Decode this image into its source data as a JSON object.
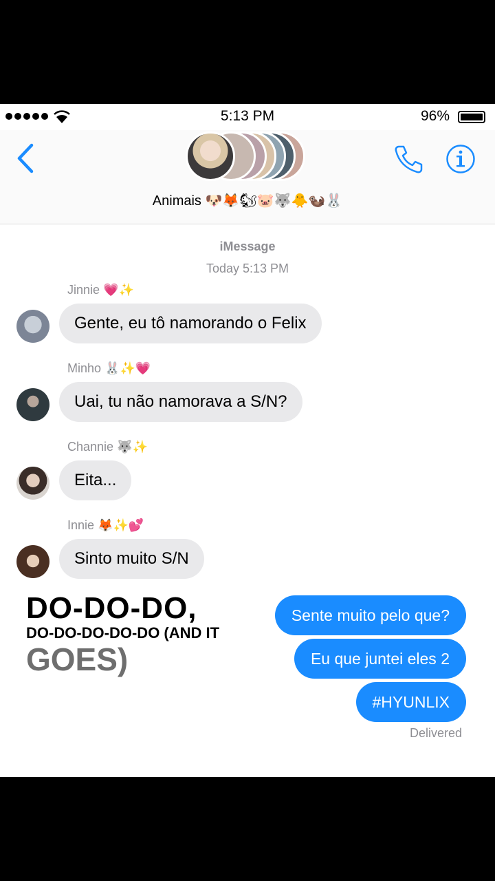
{
  "status_bar": {
    "time": "5:13 PM",
    "battery": "96%"
  },
  "header": {
    "group_name": "Animais 🐶🦊🐿🐷🐺🐥🦦🐰"
  },
  "conversation": {
    "service": "iMessage",
    "timestamp": "Today 5:13 PM",
    "incoming": [
      {
        "sender": "Jinnie 💗✨",
        "text": "Gente, eu tô namorando o Felix"
      },
      {
        "sender": "Minho 🐰✨💗",
        "text": "Uai, tu não namorava a S/N?"
      },
      {
        "sender": "Channie 🐺✨",
        "text": "Eita..."
      },
      {
        "sender": "Innie 🦊✨💕",
        "text": "Sinto muito S/N"
      }
    ],
    "outgoing": [
      {
        "text": "Sente muito pelo que?"
      },
      {
        "text": "Eu que juntei eles 2"
      },
      {
        "text": "#HYUNLIX"
      }
    ],
    "status": "Delivered"
  },
  "caption": {
    "line1": "DO-DO-DO,",
    "line2": "DO-DO-DO-DO-DO (AND IT",
    "line3": "GOES)"
  },
  "colors": {
    "accent": "#1a8cff",
    "incoming_bubble": "#e9e9eb"
  }
}
